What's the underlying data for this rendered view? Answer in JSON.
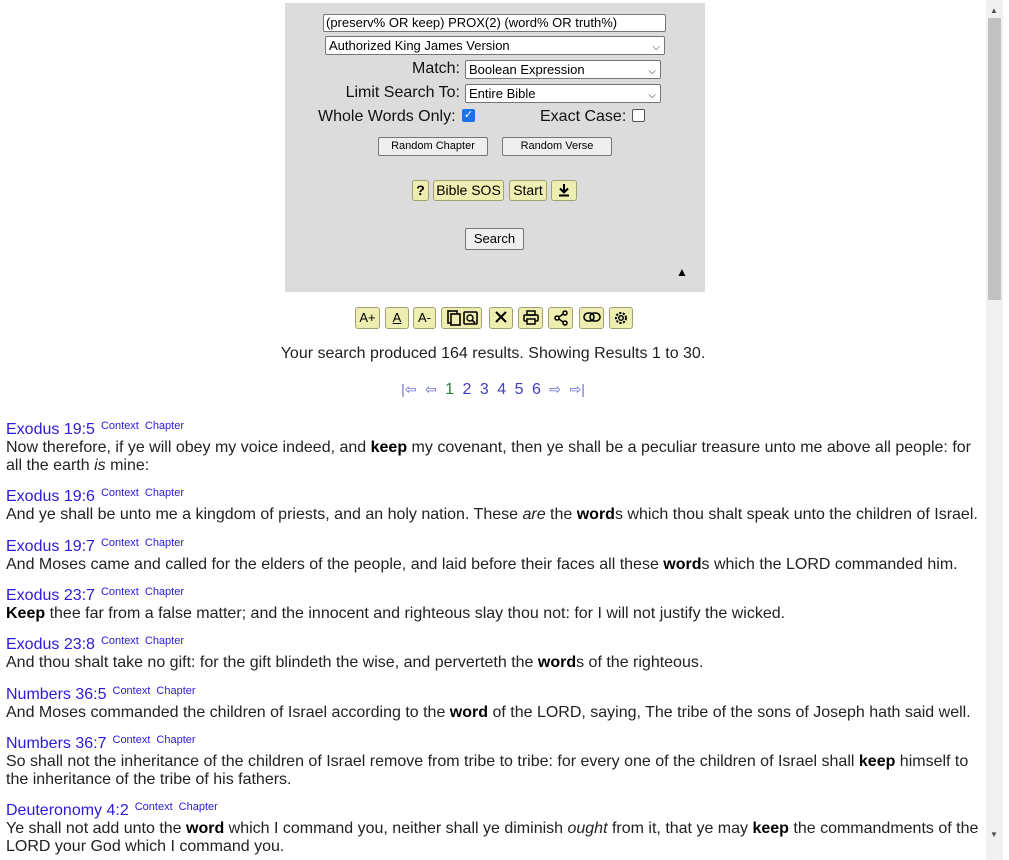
{
  "search": {
    "query": "(preserv% OR keep) PROX(2) (word% OR truth%)",
    "version": "Authorized King James Version",
    "match_label": "Match:",
    "match_value": "Boolean Expression",
    "limit_label": "Limit Search To:",
    "limit_value": "Entire Bible",
    "whole_words_label": "Whole Words Only:",
    "whole_words_checked": true,
    "exact_case_label": "Exact Case:",
    "exact_case_checked": false,
    "random_chapter": "Random Chapter",
    "random_verse": "Random Verse",
    "help": "?",
    "bible_sos": "Bible SOS",
    "start": "Start",
    "search_button": "Search",
    "collapse": "▲"
  },
  "toolbar": {
    "increase_font": "A+",
    "underline": "A",
    "decrease_font": "A-"
  },
  "summary": "Your search produced 164 results.  Showing Results 1 to 30.",
  "pager": {
    "first": "|⇦",
    "prev": "⇦",
    "pages": [
      "1",
      "2",
      "3",
      "4",
      "5",
      "6"
    ],
    "current": "1",
    "next": "⇨",
    "last": "⇨|"
  },
  "labels": {
    "context": "Context",
    "chapter": "Chapter"
  },
  "results": [
    {
      "ref": "Exodus 19:5",
      "parts": [
        [
          "t",
          "Now therefore, if ye will obey my voice indeed, and "
        ],
        [
          "b",
          "keep"
        ],
        [
          "t",
          " my covenant, then ye shall be a peculiar treasure unto me above all people: for all the earth "
        ],
        [
          "i",
          "is"
        ],
        [
          "t",
          " mine:"
        ]
      ]
    },
    {
      "ref": "Exodus 19:6",
      "parts": [
        [
          "t",
          "And ye shall be unto me a kingdom of priests, and an holy nation. These "
        ],
        [
          "i",
          "are"
        ],
        [
          "t",
          " the "
        ],
        [
          "b",
          "word"
        ],
        [
          "t",
          "s which thou shalt speak unto the children of Israel."
        ]
      ]
    },
    {
      "ref": "Exodus 19:7",
      "parts": [
        [
          "t",
          "And Moses came and called for the elders of the people, and laid before their faces all these "
        ],
        [
          "b",
          "word"
        ],
        [
          "t",
          "s which the LORD commanded him."
        ]
      ]
    },
    {
      "ref": "Exodus 23:7",
      "parts": [
        [
          "b",
          "Keep"
        ],
        [
          "t",
          " thee far from a false matter; and the innocent and righteous slay thou not: for I will not justify the wicked."
        ]
      ]
    },
    {
      "ref": "Exodus 23:8",
      "parts": [
        [
          "t",
          "And thou shalt take no gift: for the gift blindeth the wise, and perverteth the "
        ],
        [
          "b",
          "word"
        ],
        [
          "t",
          "s of the righteous."
        ]
      ]
    },
    {
      "ref": "Numbers 36:5",
      "parts": [
        [
          "t",
          "And Moses commanded the children of Israel according to the "
        ],
        [
          "b",
          "word"
        ],
        [
          "t",
          " of the LORD, saying, The tribe of the sons of Joseph hath said well."
        ]
      ]
    },
    {
      "ref": "Numbers 36:7",
      "parts": [
        [
          "t",
          "So shall not the inheritance of the children of Israel remove from tribe to tribe: for every one of the children of Israel shall "
        ],
        [
          "b",
          "keep"
        ],
        [
          "t",
          " himself to the inheritance of the tribe of his fathers."
        ]
      ]
    },
    {
      "ref": "Deuteronomy 4:2",
      "parts": [
        [
          "t",
          "Ye shall not add unto the "
        ],
        [
          "b",
          "word"
        ],
        [
          "t",
          " which I command you, neither shall ye diminish "
        ],
        [
          "i",
          "ought"
        ],
        [
          "t",
          " from it, that ye may "
        ],
        [
          "b",
          "keep"
        ],
        [
          "t",
          " the commandments of the LORD your God which I command you."
        ]
      ]
    }
  ]
}
